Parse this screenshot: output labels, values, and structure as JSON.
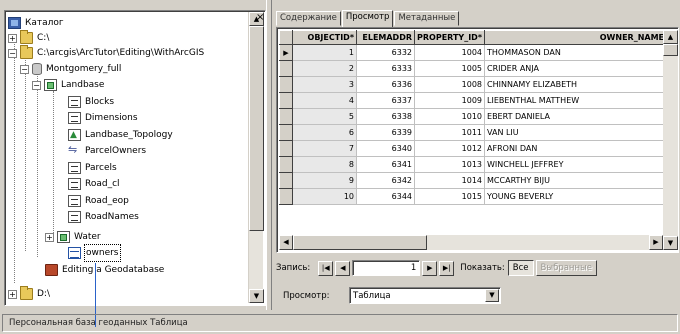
{
  "tree": {
    "items": [
      {
        "label": "Каталог",
        "icon": "catalog-icon"
      },
      {
        "label": "C:\\",
        "icon": "folder-icon"
      },
      {
        "label": "C:\\arcgis\\ArcTutor\\Editing\\WithArcGIS",
        "icon": "folder-icon"
      },
      {
        "label": "Montgomery_full",
        "icon": "geodatabase-icon"
      },
      {
        "label": "Landbase",
        "icon": "feature-dataset-icon"
      },
      {
        "label": "Blocks",
        "icon": "feature-class-icon"
      },
      {
        "label": "Dimensions",
        "icon": "feature-class-icon"
      },
      {
        "label": "Landbase_Topology",
        "icon": "topology-icon"
      },
      {
        "label": "ParcelOwners",
        "icon": "relationship-class-icon"
      },
      {
        "label": "Parcels",
        "icon": "feature-class-icon"
      },
      {
        "label": "Road_cl",
        "icon": "feature-class-icon"
      },
      {
        "label": "Road_eop",
        "icon": "feature-class-icon"
      },
      {
        "label": "RoadNames",
        "icon": "annotation-class-icon"
      },
      {
        "label": "Water",
        "icon": "feature-dataset-icon"
      },
      {
        "label": "owners",
        "icon": "table-icon"
      },
      {
        "label": "Editing a Geodatabase",
        "icon": "toolbox-icon"
      },
      {
        "label": "D:\\",
        "icon": "folder-icon"
      }
    ]
  },
  "tabs": [
    {
      "label": "Содержание"
    },
    {
      "label": "Просмотр"
    },
    {
      "label": "Метаданные"
    }
  ],
  "grid": {
    "columns": [
      "OBJECTID*",
      "ELEMADDR",
      "PROPERTY_ID*",
      "OWNER_NAME"
    ],
    "rows": [
      [
        "1",
        "6332",
        "1004",
        "THOMMASON DAN"
      ],
      [
        "2",
        "6333",
        "1005",
        "CRIDER ANJA"
      ],
      [
        "3",
        "6336",
        "1008",
        "CHINNAMY ELIZABETH"
      ],
      [
        "4",
        "6337",
        "1009",
        "LIEBENTHAL MATTHEW"
      ],
      [
        "5",
        "6338",
        "1010",
        "EBERT DANIELA"
      ],
      [
        "6",
        "6339",
        "1011",
        "VAN LIU"
      ],
      [
        "7",
        "6340",
        "1012",
        "AFRONI DAN"
      ],
      [
        "8",
        "6341",
        "1013",
        "WINCHELL JEFFREY"
      ],
      [
        "9",
        "6342",
        "1014",
        "MCCARTHY BIJU"
      ],
      [
        "10",
        "6344",
        "1015",
        "YOUNG BEVERLY"
      ]
    ]
  },
  "nav": {
    "records_label": "Запись:",
    "current_record": "1",
    "show_label": "Показать:",
    "all_button": "Все",
    "selected_button": "Выбранные"
  },
  "preview": {
    "label": "Просмотр:",
    "value": "Таблица"
  },
  "status": {
    "text": "Персональная база геоданных Таблица"
  }
}
